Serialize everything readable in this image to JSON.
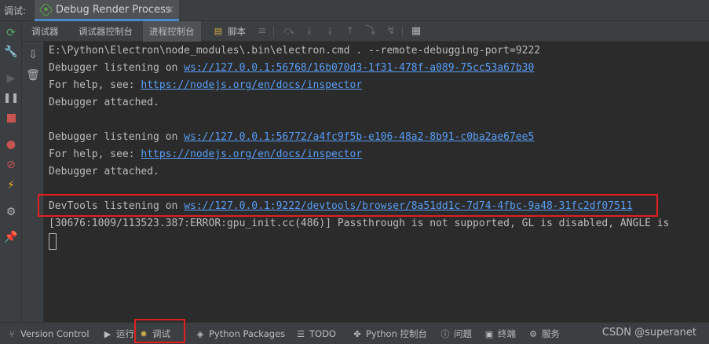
{
  "header": {
    "debug_label": "调试:",
    "run_tab_title": "Debug Render Process",
    "close_glyph": "×"
  },
  "sub_toolbar": {
    "tabs": [
      {
        "label": "调试器"
      },
      {
        "label": "调试器控制台"
      },
      {
        "label": "进程控制台"
      },
      {
        "label": "脚本"
      }
    ],
    "active_tab": "进程控制台"
  },
  "console": {
    "lines": [
      {
        "prefix": "E:\\Python\\Electron\\node_modules\\.bin\\electron.cmd . --remote-debugging-port=9222",
        "link": ""
      },
      {
        "prefix": "Debugger listening on ",
        "link": "ws://127.0.0.1:56768/16b070d3-1f31-478f-a089-75cc53a67b30"
      },
      {
        "prefix": "For help, see: ",
        "link": "https://nodejs.org/en/docs/inspector"
      },
      {
        "prefix": "Debugger attached.",
        "link": ""
      },
      {
        "prefix": "",
        "link": ""
      },
      {
        "prefix": "Debugger listening on ",
        "link": "ws://127.0.0.1:56772/a4fc9f5b-e106-48a2-8b91-c0ba2ae67ee5"
      },
      {
        "prefix": "For help, see: ",
        "link": "https://nodejs.org/en/docs/inspector"
      },
      {
        "prefix": "Debugger attached.",
        "link": ""
      },
      {
        "prefix": "",
        "link": ""
      },
      {
        "prefix": "DevTools listening on ",
        "link": "ws://127.0.0.1:9222/devtools/browser/8a51dd1c-7d74-4fbc-9a48-31fc2df07511"
      },
      {
        "prefix": "[30676:1009/113523.387:ERROR:gpu_init.cc(486)] Passthrough is not supported, GL is disabled, ANGLE is",
        "link": ""
      }
    ]
  },
  "bottom_bar": {
    "items": [
      {
        "label": "Version Control",
        "icon": "branch-icon"
      },
      {
        "label": "运行",
        "icon": "play-icon"
      },
      {
        "label": "调试",
        "icon": "bug-icon"
      },
      {
        "label": "Python Packages",
        "icon": "layers-icon"
      },
      {
        "label": "TODO",
        "icon": "list-icon"
      },
      {
        "label": "Python 控制台",
        "icon": "python-icon"
      },
      {
        "label": "问题",
        "icon": "info-icon"
      },
      {
        "label": "终端",
        "icon": "terminal-icon"
      },
      {
        "label": "服务",
        "icon": "services-icon"
      }
    ],
    "watermark": "CSDN @superanet"
  },
  "colors": {
    "background": "#2b2b2b",
    "panel": "#3c3f41",
    "link": "#589df6",
    "highlight_box": "#e02020",
    "tab_underline": "#4a88c7"
  }
}
